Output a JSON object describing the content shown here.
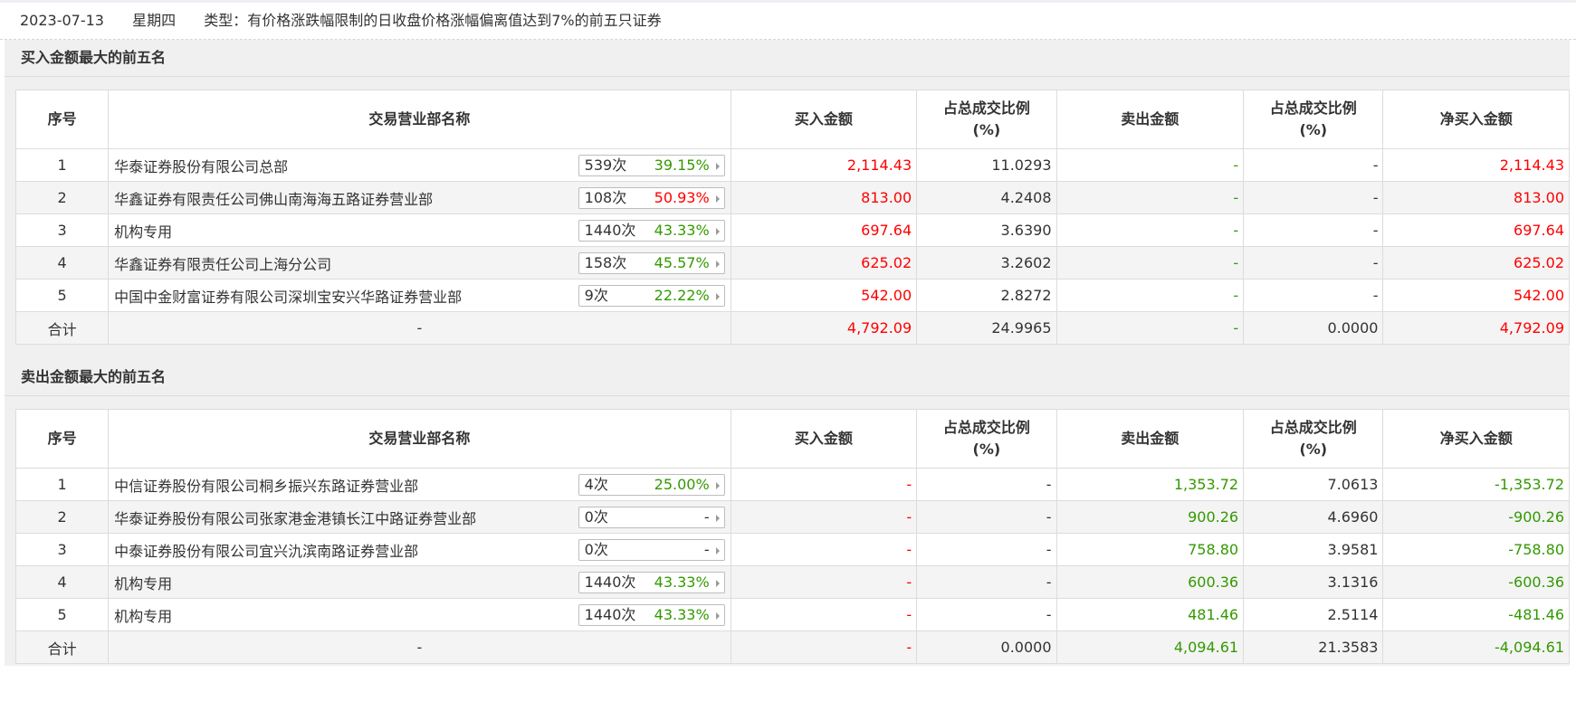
{
  "header": {
    "date": "2023-07-13",
    "weekday": "星期四",
    "type_text": "类型：有价格涨跌幅限制的日收盘价格涨幅偏离值达到7%的前五只证券"
  },
  "columns": {
    "rank": "序号",
    "dept": "交易营业部名称",
    "buy": "买入金额",
    "buy_pct": "占总成交比例",
    "sell": "卖出金额",
    "sell_pct": "占总成交比例",
    "pct_unit": "(%)",
    "net": "净买入金额"
  },
  "buy_section": {
    "title": "买入金额最大的前五名",
    "rows": [
      {
        "rank": "1",
        "name": "华泰证券股份有限公司总部",
        "count": "539次",
        "rate": "39.15%",
        "rate_color": "#339900",
        "buy": "2,114.43",
        "buy_pct": "11.0293",
        "sell": "-",
        "sell_pct": "-",
        "net": "2,114.43"
      },
      {
        "rank": "2",
        "name": "华鑫证券有限责任公司佛山南海海五路证券营业部",
        "count": "108次",
        "rate": "50.93%",
        "rate_color": "#ff0000",
        "buy": "813.00",
        "buy_pct": "4.2408",
        "sell": "-",
        "sell_pct": "-",
        "net": "813.00"
      },
      {
        "rank": "3",
        "name": "机构专用",
        "count": "1440次",
        "rate": "43.33%",
        "rate_color": "#339900",
        "buy": "697.64",
        "buy_pct": "3.6390",
        "sell": "-",
        "sell_pct": "-",
        "net": "697.64"
      },
      {
        "rank": "4",
        "name": "华鑫证券有限责任公司上海分公司",
        "count": "158次",
        "rate": "45.57%",
        "rate_color": "#339900",
        "buy": "625.02",
        "buy_pct": "3.2602",
        "sell": "-",
        "sell_pct": "-",
        "net": "625.02"
      },
      {
        "rank": "5",
        "name": "中国中金财富证券有限公司深圳宝安兴华路证券营业部",
        "count": "9次",
        "rate": "22.22%",
        "rate_color": "#339900",
        "buy": "542.00",
        "buy_pct": "2.8272",
        "sell": "-",
        "sell_pct": "-",
        "net": "542.00"
      }
    ],
    "total": {
      "label": "合计",
      "name": "-",
      "buy": "4,792.09",
      "buy_pct": "24.9965",
      "sell": "-",
      "sell_pct": "0.0000",
      "net": "4,792.09"
    }
  },
  "sell_section": {
    "title": "卖出金额最大的前五名",
    "rows": [
      {
        "rank": "1",
        "name": "中信证券股份有限公司桐乡振兴东路证券营业部",
        "count": "4次",
        "rate": "25.00%",
        "rate_color": "#339900",
        "buy": "-",
        "buy_pct": "-",
        "sell": "1,353.72",
        "sell_pct": "7.0613",
        "net": "-1,353.72"
      },
      {
        "rank": "2",
        "name": "华泰证券股份有限公司张家港金港镇长江中路证券营业部",
        "count": "0次",
        "rate": "-",
        "rate_color": "#333333",
        "buy": "-",
        "buy_pct": "-",
        "sell": "900.26",
        "sell_pct": "4.6960",
        "net": "-900.26"
      },
      {
        "rank": "3",
        "name": "中泰证券股份有限公司宜兴氿滨南路证券营业部",
        "count": "0次",
        "rate": "-",
        "rate_color": "#333333",
        "buy": "-",
        "buy_pct": "-",
        "sell": "758.80",
        "sell_pct": "3.9581",
        "net": "-758.80"
      },
      {
        "rank": "4",
        "name": "机构专用",
        "count": "1440次",
        "rate": "43.33%",
        "rate_color": "#339900",
        "buy": "-",
        "buy_pct": "-",
        "sell": "600.36",
        "sell_pct": "3.1316",
        "net": "-600.36"
      },
      {
        "rank": "5",
        "name": "机构专用",
        "count": "1440次",
        "rate": "43.33%",
        "rate_color": "#339900",
        "buy": "-",
        "buy_pct": "-",
        "sell": "481.46",
        "sell_pct": "2.5114",
        "net": "-481.46"
      }
    ],
    "total": {
      "label": "合计",
      "name": "-",
      "buy": "-",
      "buy_pct": "0.0000",
      "sell": "4,094.61",
      "sell_pct": "21.3583",
      "net": "-4,094.61"
    }
  }
}
